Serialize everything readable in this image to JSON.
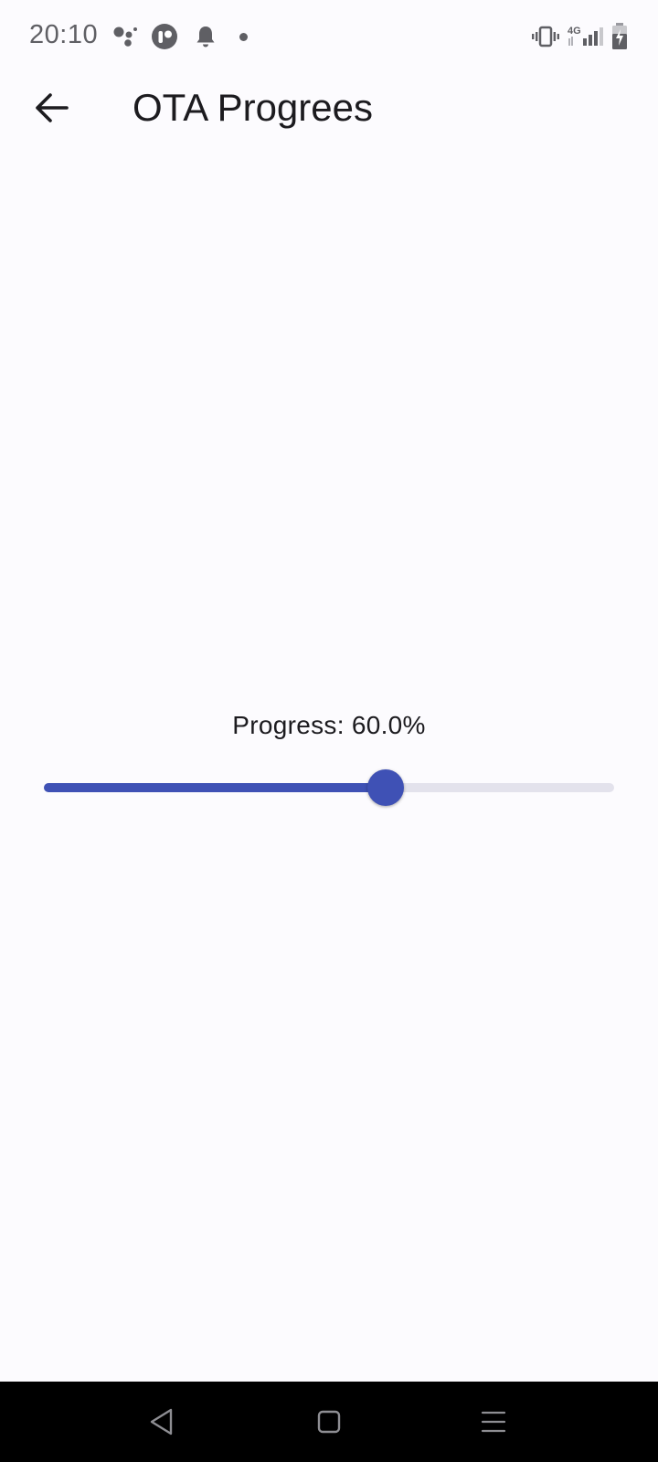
{
  "status_bar": {
    "time": "20:10",
    "network_label": "4G",
    "icons": [
      "assistant-dots-icon",
      "app-notification-icon",
      "bell-icon",
      "dot-icon",
      "vibrate-icon",
      "signal-icon",
      "battery-charging-icon"
    ]
  },
  "app_bar": {
    "title": "OTA Progrees",
    "back_icon": "arrow-back-icon"
  },
  "progress": {
    "label": "Progress: 60.0%",
    "value": 0.6
  },
  "nav_bar": {
    "icons": [
      "nav-back-icon",
      "nav-home-icon",
      "nav-menu-icon"
    ]
  },
  "colors": {
    "background": "#fcfbfe",
    "accent": "#3f51b5",
    "track": "#e3e2ec",
    "status_icon": "#5f5f64"
  }
}
